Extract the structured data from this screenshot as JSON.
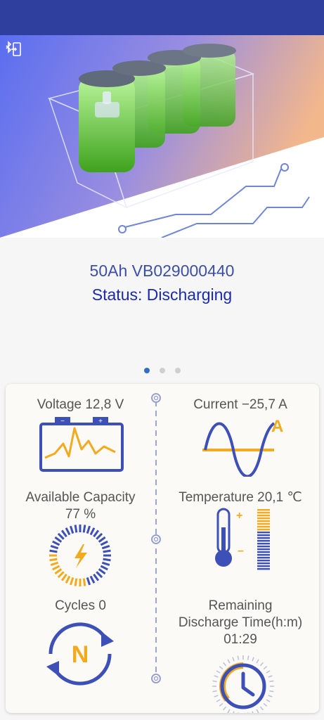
{
  "colors": {
    "status_bar": "#2e3f9e",
    "accent_blue": "#3c50b8",
    "accent_orange": "#f2aa1f",
    "title_blue": "#3c4fa8",
    "status_blue": "#1a2ab0",
    "page_indicator_active": "#2f6fc7"
  },
  "hero": {
    "image": "battery-pack-illustration",
    "bluetooth_icon": "bluetooth-disconnect-icon"
  },
  "device": {
    "name": "50Ah VB029000440",
    "status": "Status: Discharging"
  },
  "pager": {
    "pages": 3,
    "active": 0
  },
  "metrics": {
    "voltage": {
      "label": "Voltage 12,8 V",
      "icon": "battery-voltage-icon"
    },
    "current": {
      "label": "Current −25,7 A",
      "icon": "ac-current-wave-icon"
    },
    "capacity": {
      "label_line1": "Available Capacity",
      "label_line2": "77 %",
      "icon": "capacity-gauge-icon",
      "value_fraction": 0.77
    },
    "temperature": {
      "label": "Temperature 20,1 ℃",
      "icon": "thermometer-icon"
    },
    "cycles": {
      "label": "Cycles 0",
      "icon": "cycle-n-icon",
      "letter": "N"
    },
    "remaining": {
      "label_line1": "Remaining",
      "label_line2": "Discharge Time(h:m)",
      "label_line3": "01:29",
      "icon": "clock-icon"
    }
  }
}
